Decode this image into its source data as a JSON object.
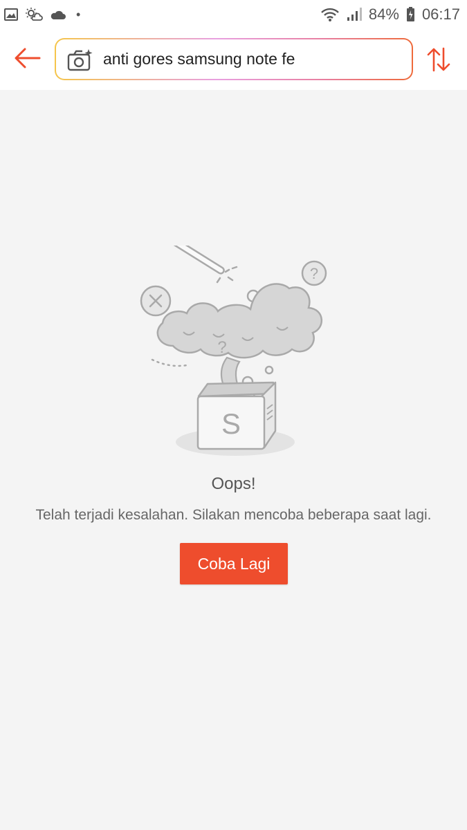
{
  "status_bar": {
    "battery": "84%",
    "time": "06:17",
    "icons": [
      "gallery-icon",
      "weather-icon",
      "cloud-icon",
      "wifi-icon",
      "signal-icon",
      "battery-icon"
    ]
  },
  "header": {
    "search": {
      "value": "anti gores samsung note fe",
      "placeholder": ""
    },
    "icons": [
      "back-arrow-icon",
      "camera-icon",
      "sort-icon"
    ],
    "accent": "#ee4d2d"
  },
  "error": {
    "title": "Oops!",
    "message": "Telah terjadi kesalahan. Silakan mencoba beberapa saat lagi.",
    "retry_label": "Coba Lagi",
    "box_letter": "S"
  },
  "colors": {
    "brand": "#ee4d2d",
    "background": "#f4f4f4"
  }
}
